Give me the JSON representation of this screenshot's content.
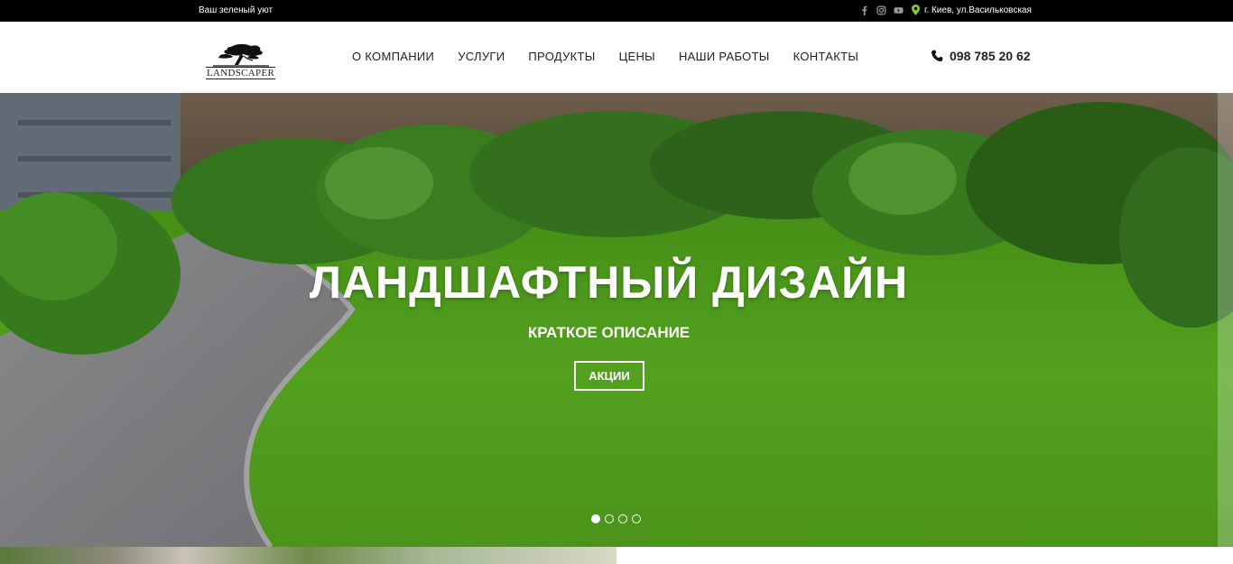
{
  "topbar": {
    "slogan": "Ваш зеленый уют",
    "socials": [
      "facebook-icon",
      "instagram-icon",
      "youtube-icon"
    ],
    "address": "г. Киев, ул.Васильковская"
  },
  "header": {
    "logo_text": "LANDSCAPER",
    "nav": [
      "О КОМПАНИИ",
      "УСЛУГИ",
      "ПРОДУКТЫ",
      "ЦЕНЫ",
      "НАШИ РАБОТЫ",
      "КОНТАКТЫ"
    ],
    "phone": "098 785 20 62"
  },
  "hero": {
    "title": "ЛАНДШАФТНЫЙ ДИЗАЙН",
    "subtitle": "КРАТКОЕ ОПИСАНИЕ",
    "button": "АКЦИИ",
    "slides": 4,
    "active_slide": 1
  },
  "colors": {
    "topbar_bg": "#000000",
    "accent": "#8ac43f",
    "text": "#222222"
  }
}
